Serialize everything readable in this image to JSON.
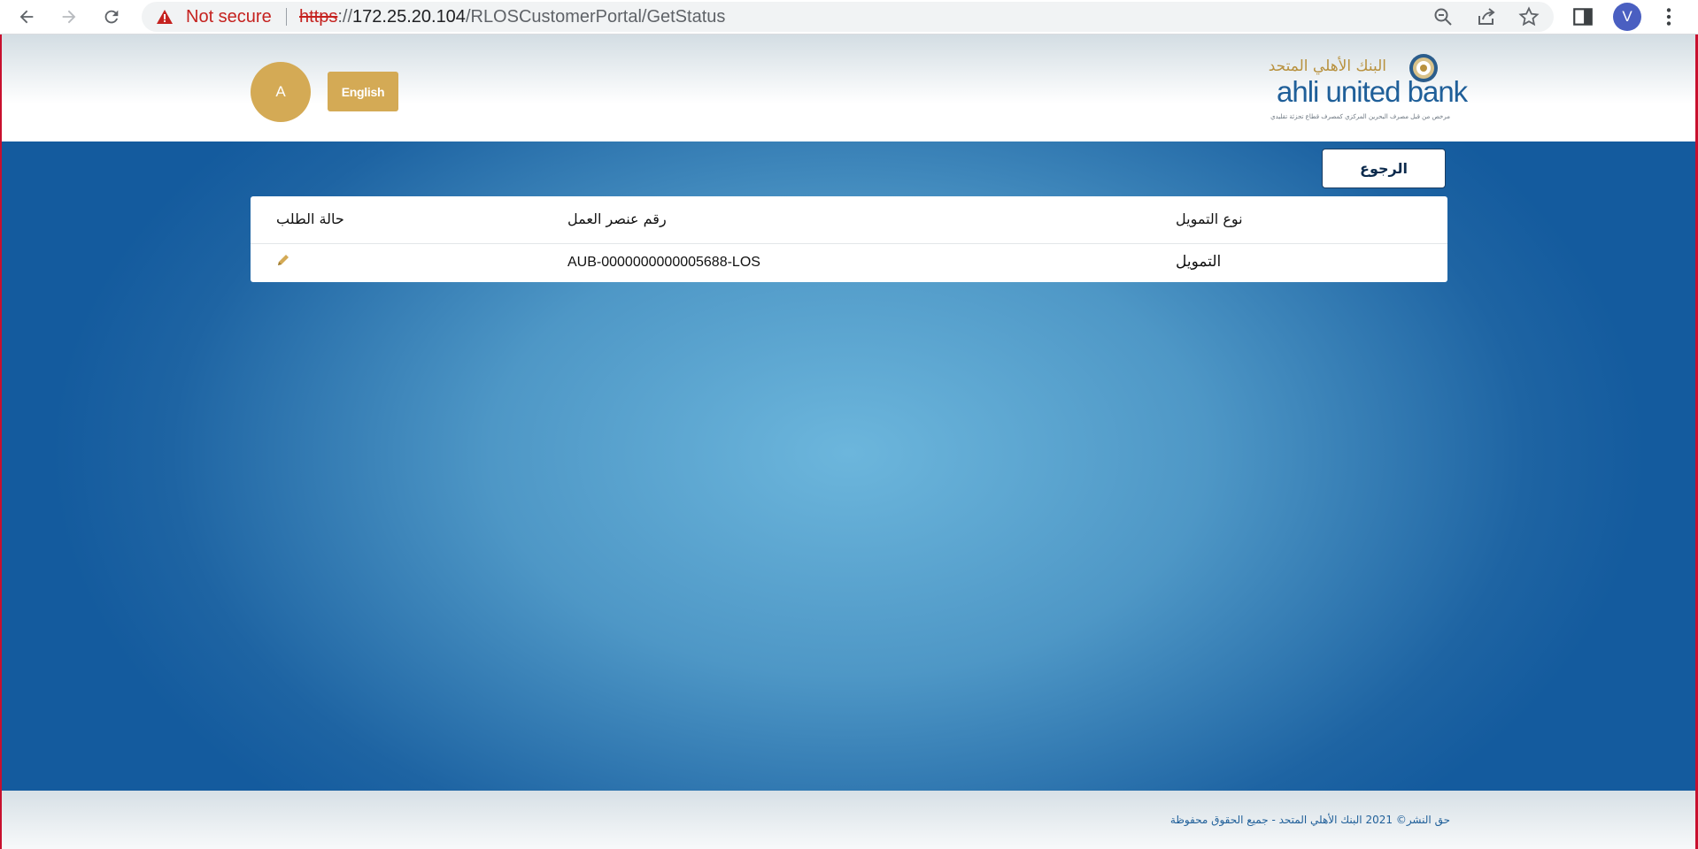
{
  "browser": {
    "security_label": "Not secure",
    "url_scheme": "https",
    "url_sep": "://",
    "url_host": "172.25.20.104",
    "url_path": "/RLOSCustomerPortal/GetStatus",
    "profile_initial": "V"
  },
  "header": {
    "user_initial": "A",
    "language_button": "English",
    "logo_arabic": "البنك الأهلي المتحد",
    "logo_english": "ahli united bank",
    "logo_tagline": "مرخص من قبل مصرف البحرين المركزي كمصرف قطاع تجزئة تقليدي"
  },
  "main": {
    "back_button": "الرجوع",
    "table": {
      "headers": {
        "status": "حالة الطلب",
        "work_item": "رقم عنصر العمل",
        "finance_type": "نوع التمويل"
      },
      "rows": [
        {
          "status_icon": "pencil-icon",
          "work_item": "AUB-0000000000005688-LOS",
          "finance_type": "التمويل"
        }
      ]
    }
  },
  "footer": {
    "copyright": "حق النشر© 2021 البنك الأهلي المتحد - جميع الحقوق محفوظة"
  },
  "colors": {
    "accent_gold": "#d4aa55",
    "brand_blue": "#1f5f99",
    "frame_red": "#c8102e"
  }
}
